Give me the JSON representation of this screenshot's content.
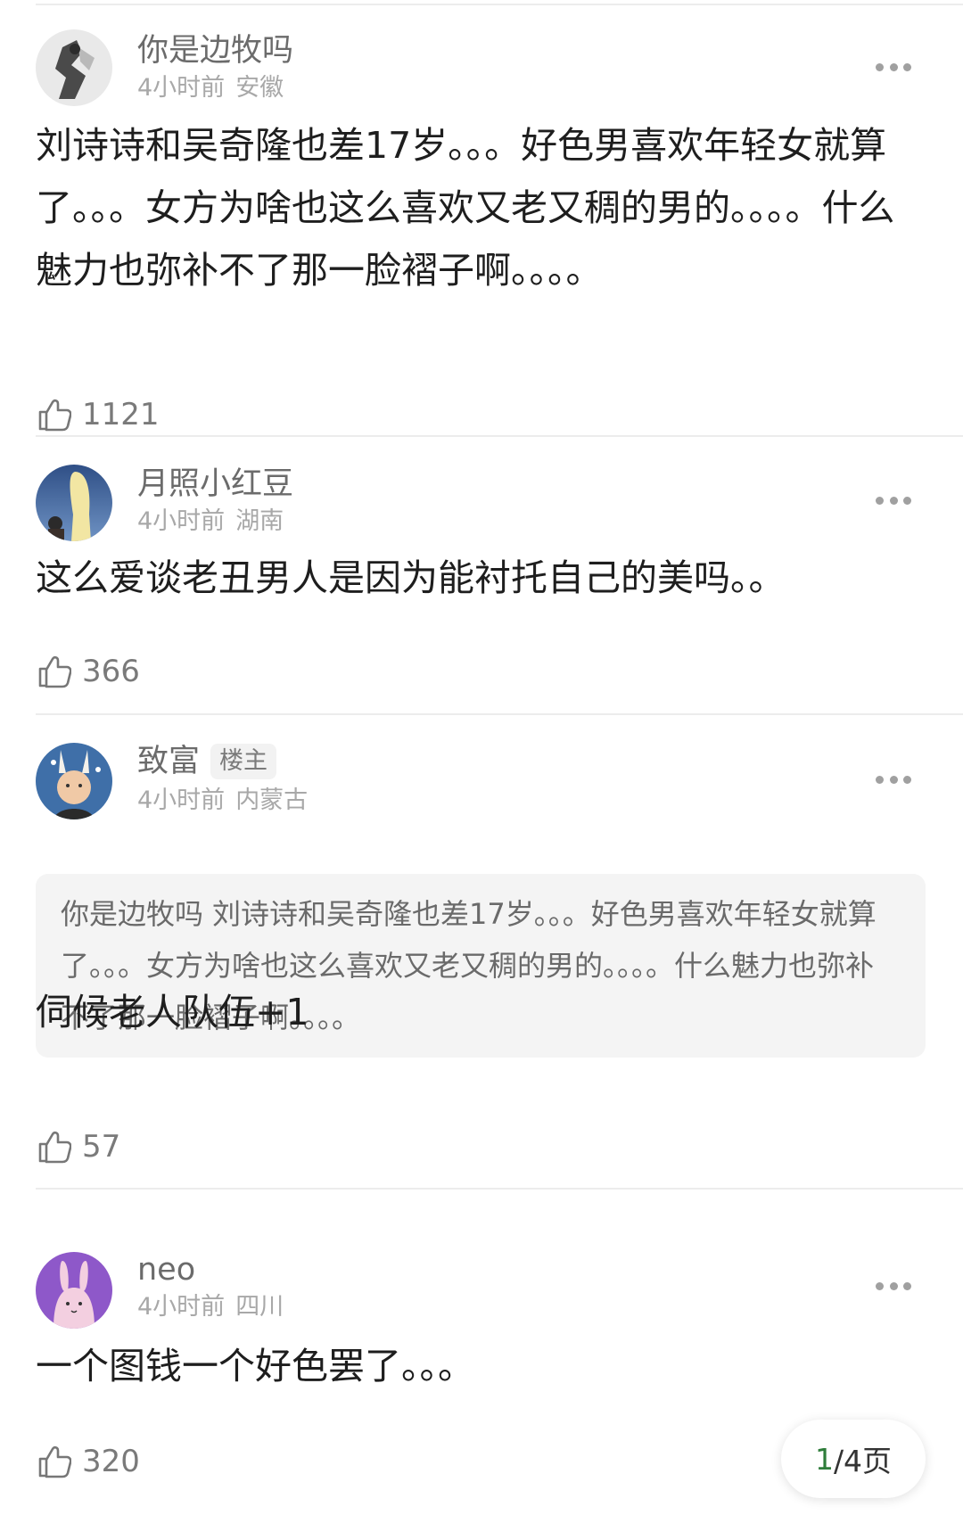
{
  "comments": [
    {
      "user": "你是边牧吗",
      "time": "4小时前",
      "location": "安徽",
      "text": "刘诗诗和吴奇隆也差17岁。。。好色男喜欢年轻女就算了。。。女方为啥也这么喜欢又老又稠的男的。。。。什么魅力也弥补不了那一脸褶子啊。。。。",
      "likes": "1121"
    },
    {
      "user": "月照小红豆",
      "time": "4小时前",
      "location": "湖南",
      "text": "这么爱谈老丑男人是因为能衬托自己的美吗。。",
      "likes": "366"
    },
    {
      "user": "致富",
      "badge": "楼主",
      "time": "4小时前",
      "location": "内蒙古",
      "quote_author": "你是边牧吗",
      "quote_text": "刘诗诗和吴奇隆也差17岁。。。好色男喜欢年轻女就算了。。。女方为啥也这么喜欢又老又稠的男的。。。。什么魅力也弥补不了那一脸褶子啊。。。。",
      "text": "伺候老人队伍+1",
      "likes": "57"
    },
    {
      "user": "neo",
      "time": "4小时前",
      "location": "四川",
      "text": "一个图钱一个好色罢了。。。",
      "likes": "320"
    }
  ],
  "pager": {
    "current": "1",
    "separator": "/4页"
  },
  "icons": {
    "like": "thumbs-up-icon",
    "more": "more-dots-icon"
  }
}
